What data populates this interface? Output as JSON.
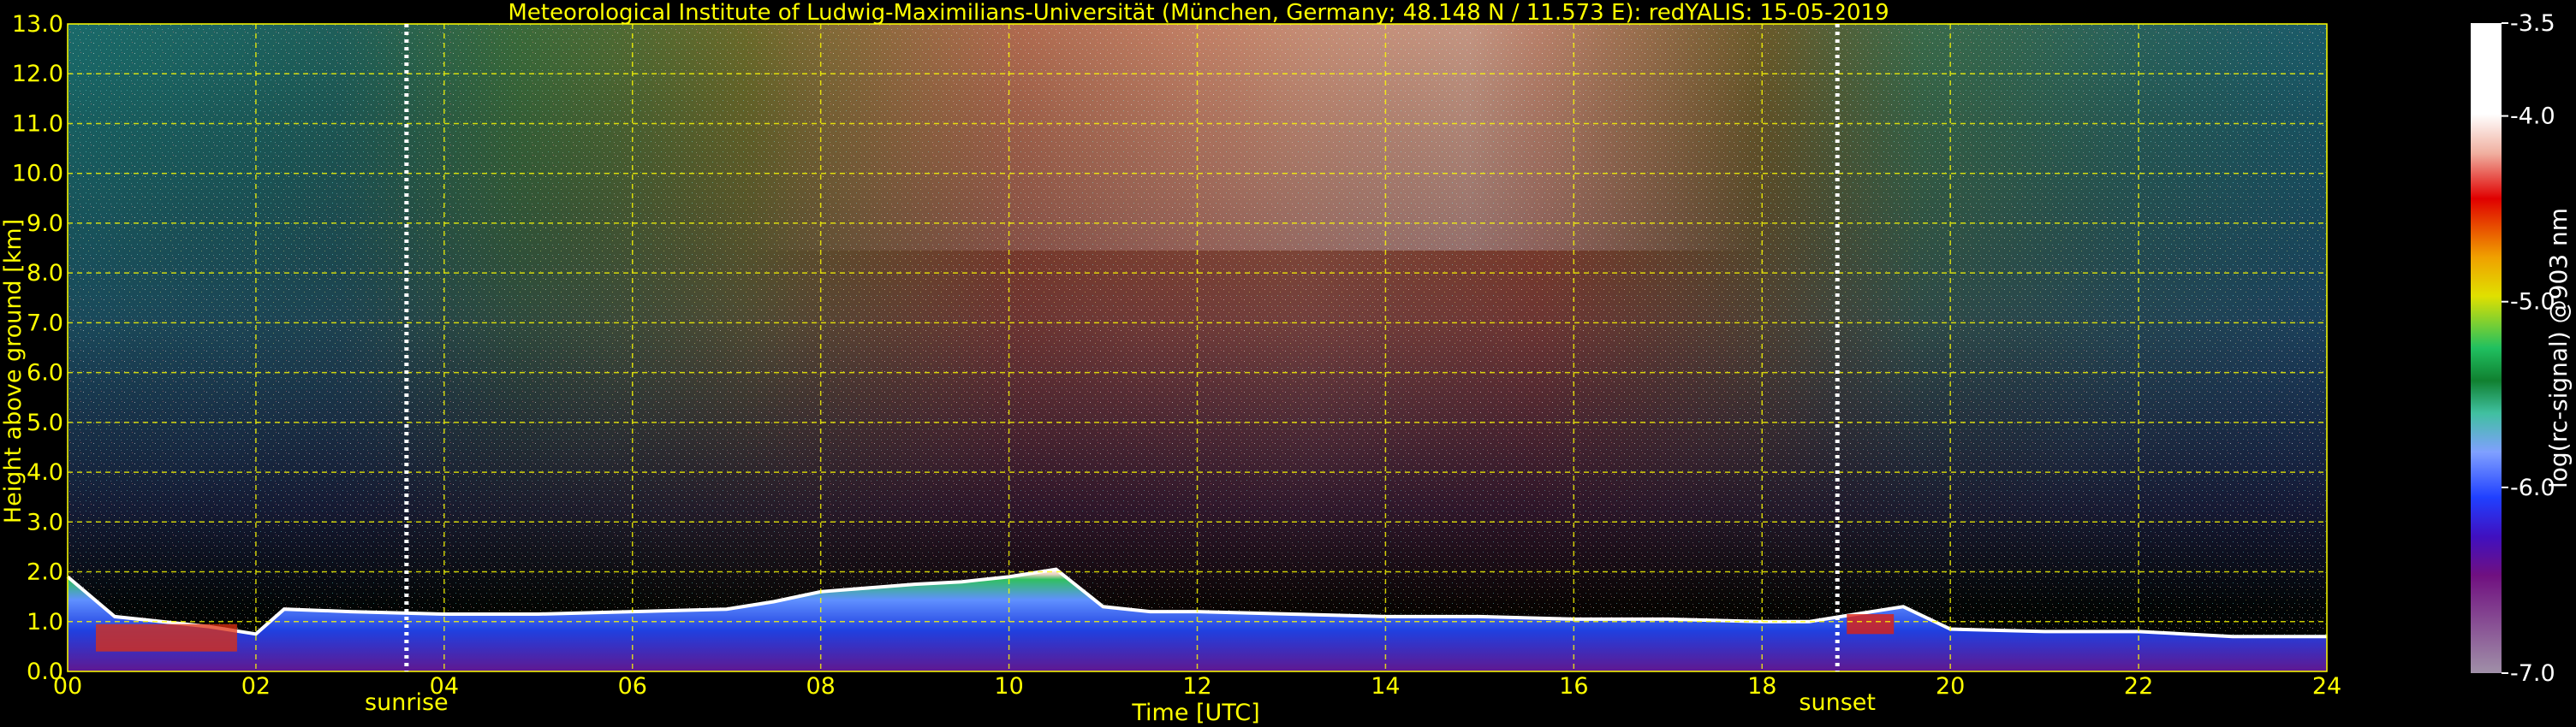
{
  "chart_data": {
    "type": "heatmap",
    "title": "Meteorological Institute of Ludwig-Maximilians-Universität (München, Germany; 48.148 N / 11.573 E):    redYALIS: 15-05-2019",
    "xlabel": "Time [UTC]",
    "ylabel": "Height above ground [km]",
    "xlim": [
      0,
      24
    ],
    "ylim": [
      0,
      13
    ],
    "x_ticks": [
      "00",
      "02",
      "04",
      "06",
      "08",
      "10",
      "12",
      "14",
      "16",
      "18",
      "20",
      "22",
      "24"
    ],
    "y_ticks": [
      "0.0",
      "1.0",
      "2.0",
      "3.0",
      "4.0",
      "5.0",
      "6.0",
      "7.0",
      "8.0",
      "9.0",
      "10.0",
      "11.0",
      "12.0",
      "13.0"
    ],
    "grid": true,
    "annotations": [
      {
        "text": "sunrise",
        "x": 3.6
      },
      {
        "text": "sunset",
        "x": 18.8
      }
    ],
    "colorbar": {
      "label": "log(rc-signal) @903 nm",
      "range": [
        -7.0,
        -3.5
      ],
      "ticks": [
        "-3.5",
        "-4.0",
        "-5.0",
        "-6.0",
        "-7.0"
      ]
    },
    "boundary_layer_top_km": {
      "x": [
        0,
        0.5,
        1,
        1.5,
        2,
        2.3,
        3,
        4,
        5,
        6,
        7,
        7.5,
        8,
        9,
        9.5,
        10,
        10.5,
        11,
        11.5,
        12,
        13,
        14,
        15,
        16,
        17,
        18,
        18.5,
        19,
        19.5,
        20,
        21,
        22,
        23,
        24
      ],
      "y": [
        1.9,
        1.1,
        1.0,
        0.9,
        0.75,
        1.25,
        1.2,
        1.15,
        1.15,
        1.2,
        1.25,
        1.4,
        1.6,
        1.75,
        1.8,
        1.9,
        2.05,
        1.3,
        1.2,
        1.2,
        1.15,
        1.1,
        1.1,
        1.05,
        1.05,
        1.0,
        1.0,
        1.15,
        1.3,
        0.85,
        0.8,
        0.8,
        0.7,
        0.7
      ]
    }
  }
}
